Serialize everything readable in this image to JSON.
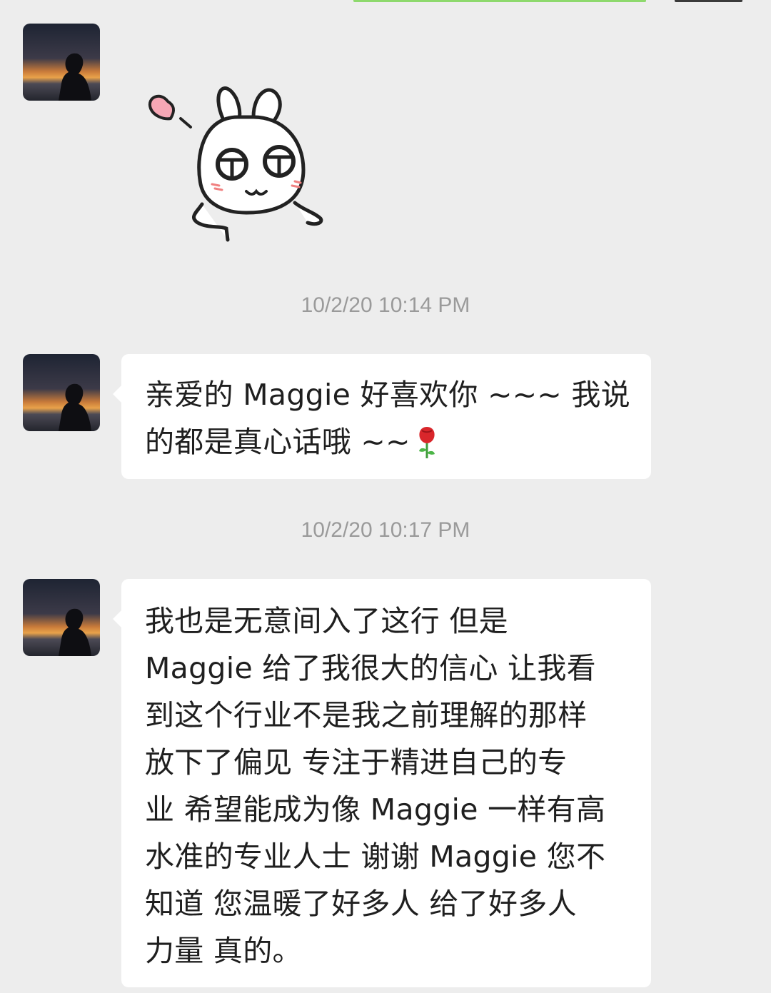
{
  "chat": {
    "messages": [
      {
        "sender_avatar": "silhouette-sunset-avatar",
        "type": "sticker",
        "sticker": "white-bunny-heart-sticker"
      },
      {
        "timestamp": "10/2/20 10:14 PM",
        "sender_avatar": "silhouette-sunset-avatar",
        "type": "text",
        "lines": [
          "亲爱的 Maggie 好喜欢你 ~~~ 我说",
          "的都是真心话哦 ~~"
        ],
        "emoji": "rose-icon"
      },
      {
        "timestamp": "10/2/20 10:17 PM",
        "sender_avatar": "silhouette-sunset-avatar",
        "type": "text",
        "lines": [
          "我也是无意间入了这行 但是",
          "Maggie 给了我很大的信心 让我看",
          "到这个行业不是我之前理解的那样",
          "放下了偏见 专注于精进自己的专",
          "业 希望能成为像 Maggie 一样有高",
          "水准的专业人士  谢谢 Maggie 您不",
          "知道 您温暖了好多人 给了好多人",
          "力量 真的。"
        ]
      }
    ]
  },
  "colors": {
    "background": "#ededed",
    "bubble": "#ffffff",
    "text": "#1f1f1f",
    "timestamp": "#9a9a9a"
  }
}
